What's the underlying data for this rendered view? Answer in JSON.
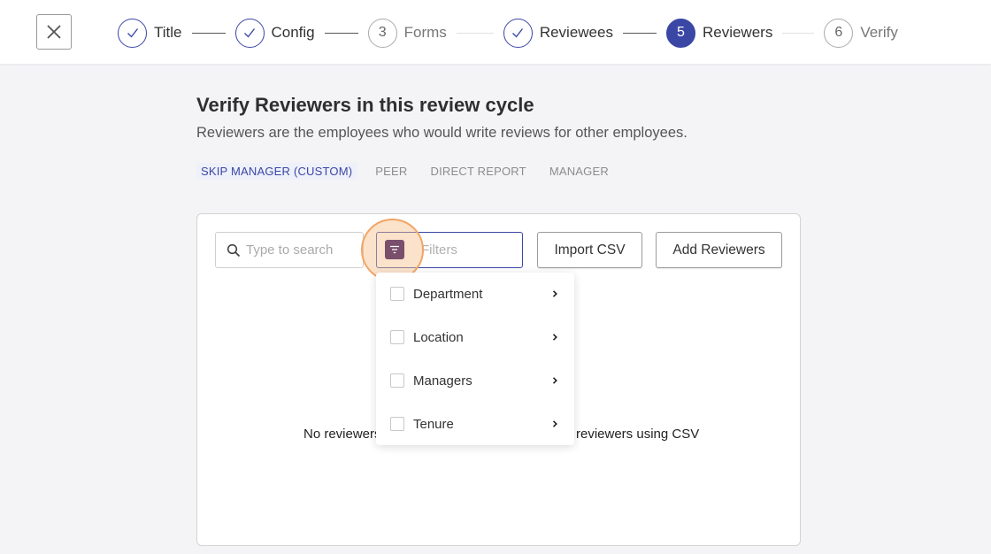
{
  "wizard": {
    "close_icon": "close-icon",
    "steps": [
      {
        "number": "",
        "label": "Title",
        "state": "done"
      },
      {
        "number": "",
        "label": "Config",
        "state": "done"
      },
      {
        "number": "3",
        "label": "Forms",
        "state": "pending"
      },
      {
        "number": "",
        "label": "Reviewees",
        "state": "done"
      },
      {
        "number": "5",
        "label": "Reviewers",
        "state": "active"
      },
      {
        "number": "6",
        "label": "Verify",
        "state": "pending"
      }
    ]
  },
  "page": {
    "title": "Verify Reviewers in this review cycle",
    "subtitle": "Reviewers are the employees who would write reviews for other employees."
  },
  "tabs": [
    "SKIP MANAGER (CUSTOM)",
    "PEER",
    "DIRECT REPORT",
    "MANAGER"
  ],
  "toolbar": {
    "search_placeholder": "Type to search",
    "filters_label": "Filters",
    "import_label": "Import CSV",
    "add_label": "Add Reviewers"
  },
  "filter_menu": {
    "items": [
      "Department",
      "Location",
      "Managers",
      "Tenure"
    ]
  },
  "empty_state": {
    "left": "No reviewers",
    "right": "reviewers using CSV"
  },
  "colors": {
    "accent": "#3b47a5",
    "highlight": "#f2a565",
    "filter_icon_bg": "#7a4f6b"
  }
}
